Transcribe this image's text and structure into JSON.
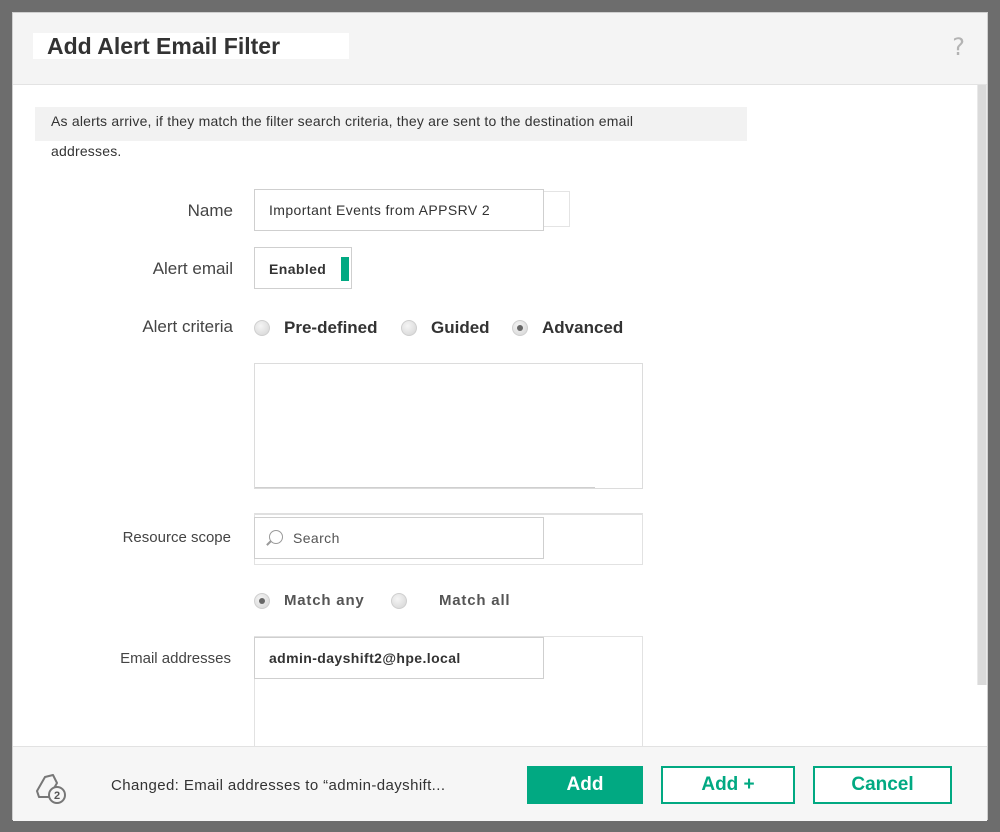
{
  "dialog": {
    "title": "Add Alert Email Filter",
    "help_symbol": "?",
    "description_line1": "As  alerts arrive, if they match the filter search criteria, they are sent to the destination email",
    "description_line2": "addresses."
  },
  "form": {
    "name_label": "Name",
    "name_value": "Important Events from APPSRV 2",
    "alert_email_label": "Alert email",
    "alert_email_toggle": "Enabled",
    "alert_criteria_label": "Alert criteria",
    "criteria_options": [
      {
        "label": "Pre-defined",
        "checked": false
      },
      {
        "label": "Guided",
        "checked": false
      },
      {
        "label": "Advanced",
        "checked": true
      }
    ],
    "resource_scope_label": "Resource scope",
    "search_placeholder": "Search",
    "match_options": [
      {
        "label": "Match any",
        "checked": true
      },
      {
        "label": "Match all",
        "checked": false
      }
    ],
    "email_label": "Email addresses",
    "email_value": "admin-dayshift2@hpe.local"
  },
  "footer": {
    "changes_count": "2",
    "status_text": "Changed: Email addresses to “admin-dayshift...",
    "add_label": "Add",
    "add_plus_label": "Add +",
    "cancel_label": "Cancel"
  },
  "colors": {
    "accent": "#01a982",
    "overlay": "#6d6d6d"
  }
}
